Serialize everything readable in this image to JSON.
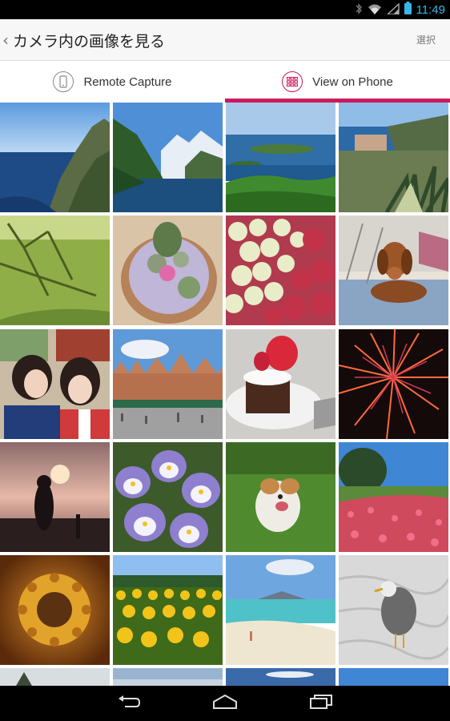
{
  "statusbar": {
    "time": "11:49"
  },
  "actionbar": {
    "title": "カメラ内の画像を見る",
    "select_label": "選択"
  },
  "tabs": [
    {
      "label": "Remote Capture",
      "icon": "phone-icon",
      "active": false
    },
    {
      "label": "View on Phone",
      "icon": "grid-icon",
      "active": true
    }
  ],
  "accent_color": "#cc1a5c",
  "photos": [
    {
      "subject": "coastal-cliff"
    },
    {
      "subject": "mountain-fjord"
    },
    {
      "subject": "islands-bay"
    },
    {
      "subject": "seaside-village-agave"
    },
    {
      "subject": "lawn-shadow"
    },
    {
      "subject": "cactus-flowers"
    },
    {
      "subject": "fruit-pile"
    },
    {
      "subject": "dachshund-on-rug"
    },
    {
      "subject": "two-girls-selfie"
    },
    {
      "subject": "european-town-square"
    },
    {
      "subject": "strawberry-cake"
    },
    {
      "subject": "fireworks"
    },
    {
      "subject": "sunset-silhouette"
    },
    {
      "subject": "violets"
    },
    {
      "subject": "terrier-on-grass"
    },
    {
      "subject": "tulip-field"
    },
    {
      "subject": "sunflower-fisheye"
    },
    {
      "subject": "sunflower-field"
    },
    {
      "subject": "beach-shore"
    },
    {
      "subject": "seagull-on-sand"
    },
    {
      "subject": "partial-1"
    },
    {
      "subject": "partial-2"
    },
    {
      "subject": "partial-3"
    },
    {
      "subject": "partial-4"
    }
  ]
}
